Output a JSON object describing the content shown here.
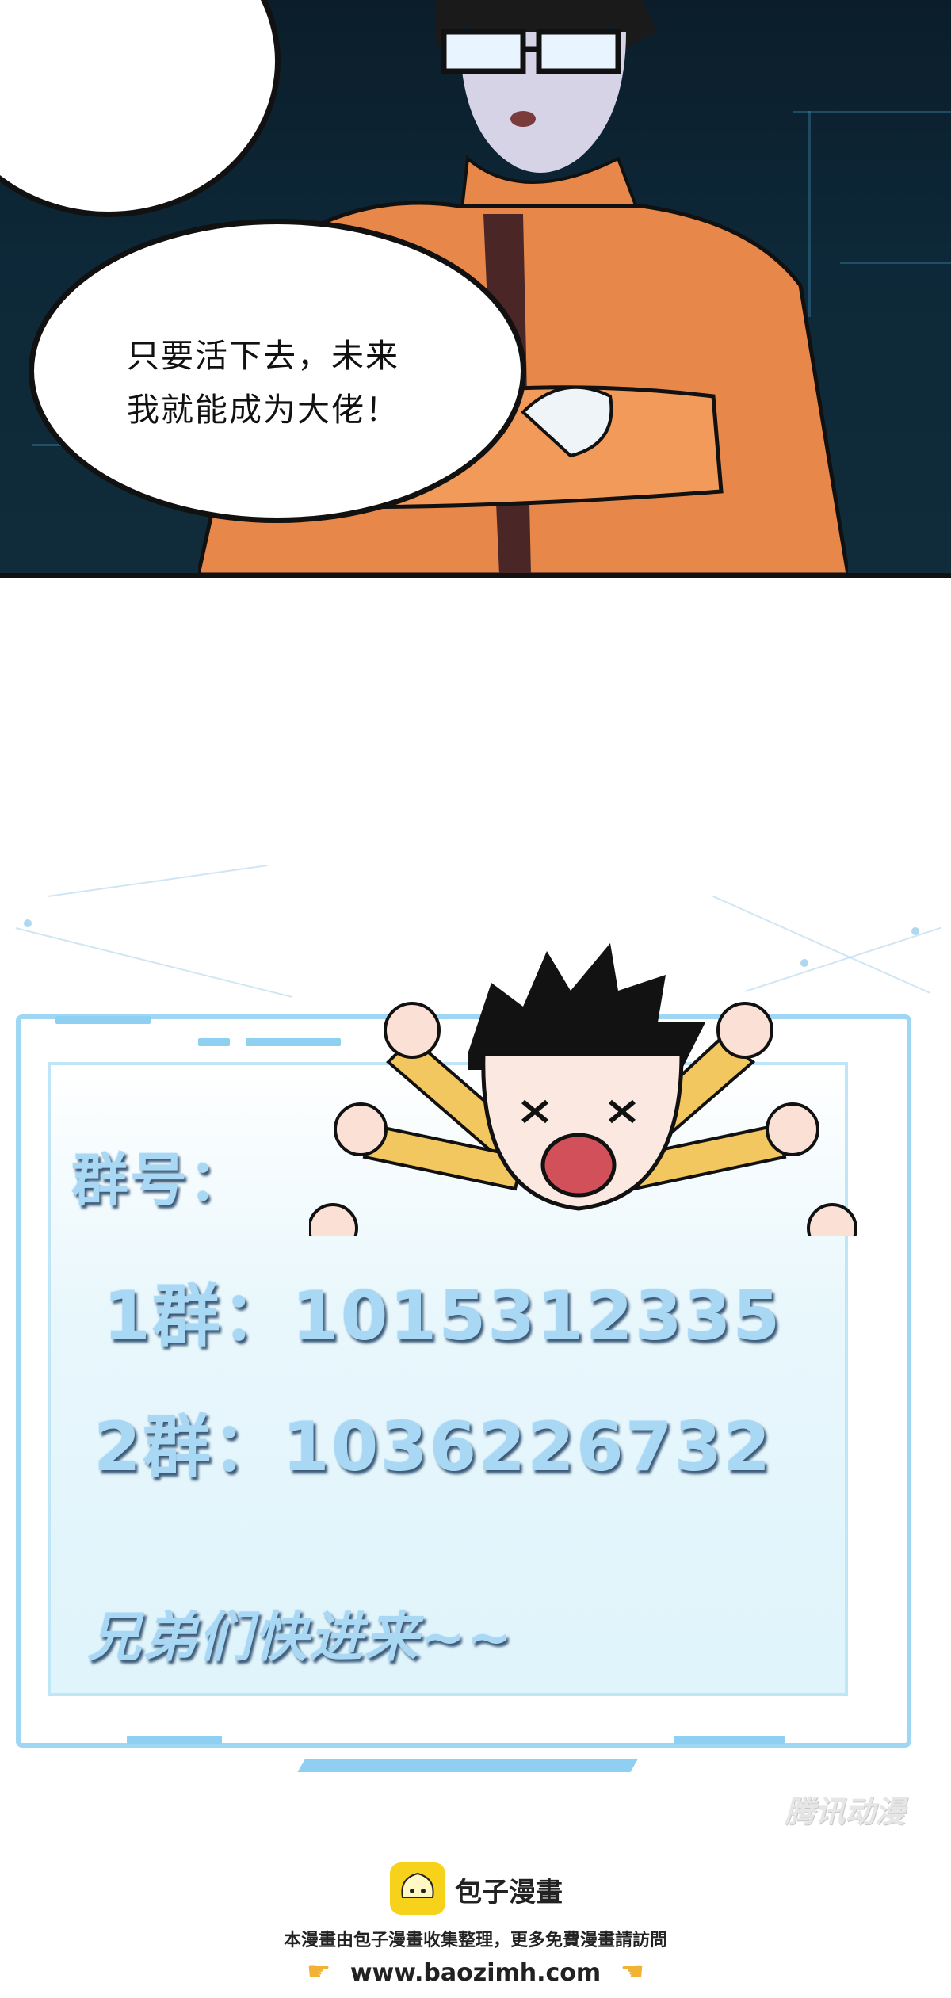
{
  "panel1": {
    "speech_line1": "只要活下去，未来",
    "speech_line2": "我就能成为大佬！"
  },
  "promo": {
    "title": "群号：",
    "line1": "1群：1015312335",
    "line2": "2群：1036226732",
    "cta": "兄弟们快进来~~",
    "watermark": "腾讯动漫"
  },
  "footer": {
    "brand": "包子漫畫",
    "note": "本漫畫由包子漫畫收集整理，更多免費漫畫請訪問",
    "url": "www.baozimh.com",
    "left_icon": "pointing-hand-icon",
    "right_icon": "pointing-hand-icon"
  },
  "colors": {
    "panel_bg": "#0d2838",
    "jacket": "#e8874a",
    "frame": "#9fd6f3",
    "text_blue": "#a9d8f5",
    "logo_yellow": "#f6d21b"
  }
}
